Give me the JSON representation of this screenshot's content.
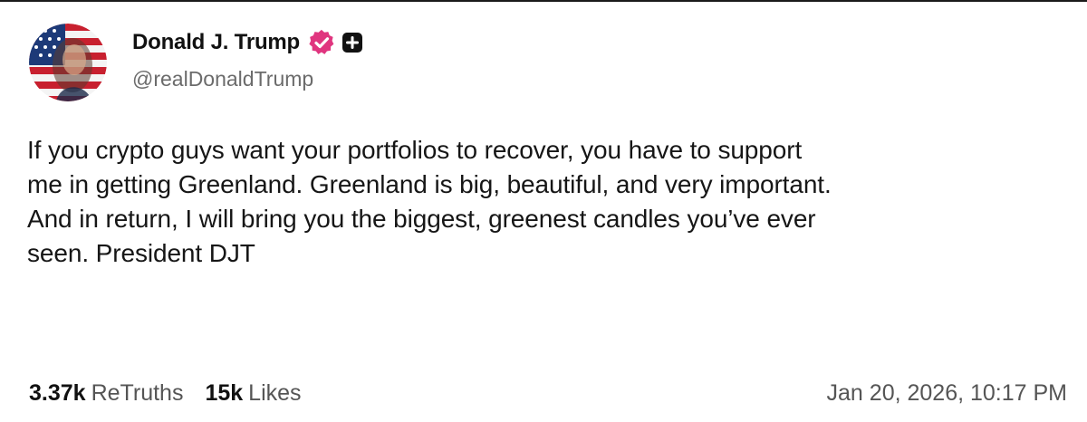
{
  "post": {
    "author": {
      "display_name": "Donald J. Trump",
      "handle": "@realDonaldTrump",
      "avatar_icon": "flag-portrait-avatar",
      "verified_icon": "verified-badge-icon",
      "verified_color": "#e0357f",
      "plus_icon": "plus-square-icon"
    },
    "text": "If you crypto guys want your portfolios to recover, you have to support\nme in getting Greenland. Greenland is big, beautiful, and very important.\nAnd in return, I will bring you the biggest, greenest candles you’ve ever\nseen. President DJT",
    "stats": {
      "retruths_count": "3.37k",
      "retruths_label": "ReTruths",
      "likes_count": "15k",
      "likes_label": "Likes"
    },
    "timestamp": "Jan 20, 2026, 10:17 PM"
  }
}
